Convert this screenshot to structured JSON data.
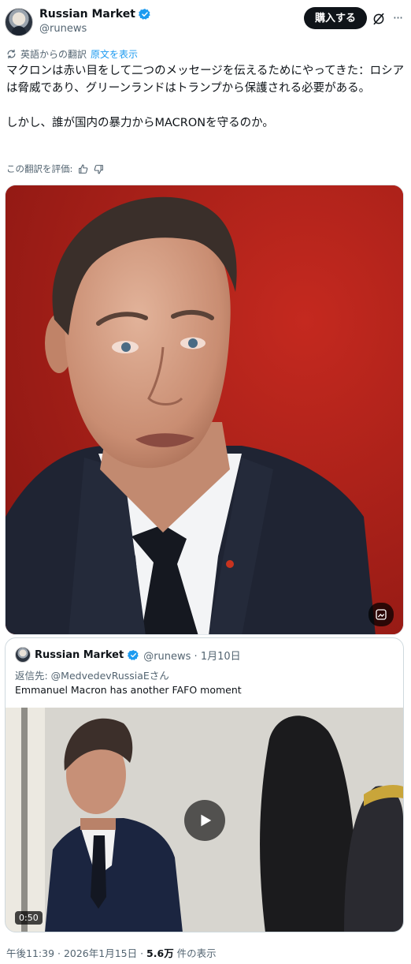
{
  "author": {
    "name": "Russian Market",
    "handle": "@runews"
  },
  "header": {
    "buy_label": "購入する"
  },
  "translation": {
    "from_label": "英語からの翻訳",
    "show_original": "原文を表示",
    "rate_label": "この翻訳を評価:"
  },
  "post": {
    "paragraph1": "マクロンは赤い目をして二つのメッセージを伝えるためにやってきた：ロシアは脅威であり、グリーンランドはトランプから保護される必要がある。",
    "paragraph2": "しかし、誰が国内の暴力からMACRONを守るのか。"
  },
  "quote": {
    "name": "Russian Market",
    "meta": "@runews · 1月10日",
    "reply_to": "返信先: @MedvedevRussiaEさん",
    "text": "Emmanuel Macron has another FAFO moment",
    "duration": "0:50"
  },
  "footer": {
    "time_date": "午後11:39 · 2026年1月15日 · ",
    "views_count": "5.6万",
    "views_label": " 件の表示"
  },
  "colors": {
    "accent": "#1d9bf0",
    "image_background": "#b4241c",
    "button_dark": "#0f1419"
  },
  "icons": [
    "verified-badge-icon",
    "grok-icon",
    "more-icon",
    "translate-icon",
    "thumbs-up-icon",
    "thumbs-down-icon",
    "alt-text-icon",
    "play-icon"
  ]
}
